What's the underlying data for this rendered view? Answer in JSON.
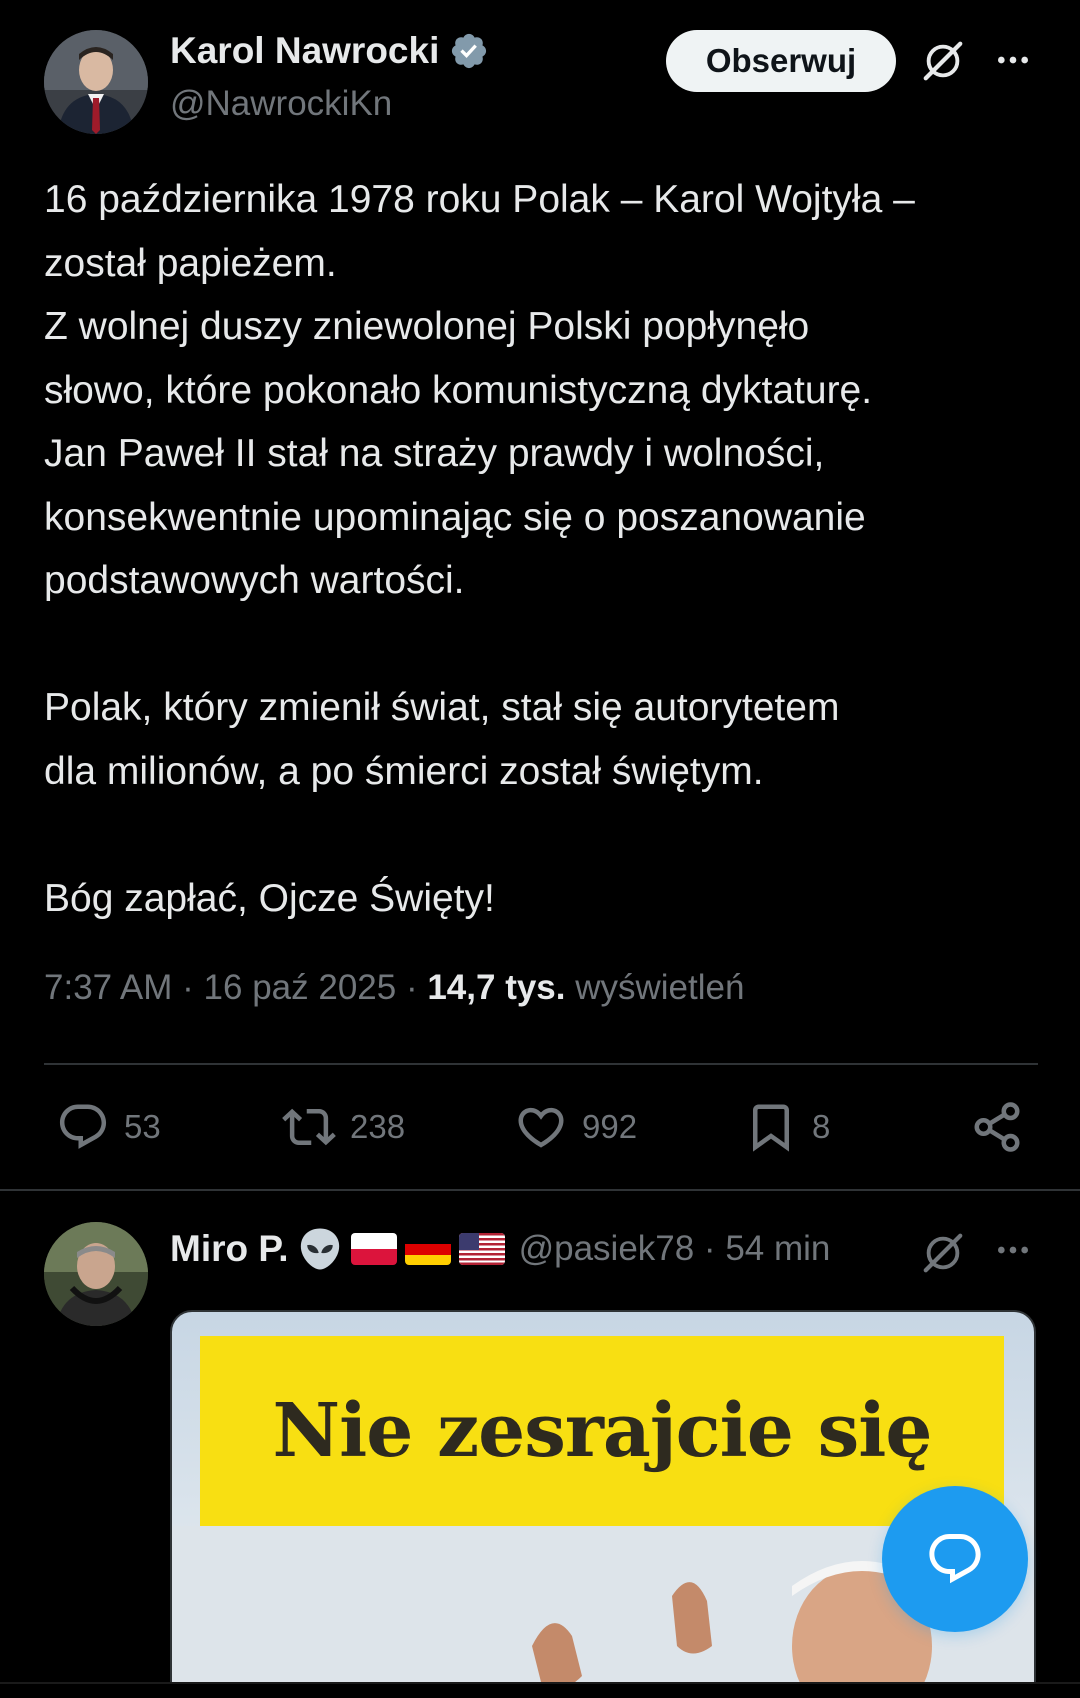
{
  "main_tweet": {
    "author_name": "Karol Nawrocki",
    "author_handle": "@NawrockiKn",
    "follow_label": "Obserwuj",
    "text": "16 października 1978 roku Polak – Karol Wojtyła –\nzostał papieżem.\nZ wolnej duszy zniewolonej Polski popłynęło\nsłowo, które pokonało komunistyczną dyktaturę.\nJan Paweł II stał na straży prawdy i wolności,\nkonsekwentnie upominając się o poszanowanie\npodstawowych wartości.\n\nPolak, który zmienił świat, stał się autorytetem\ndla milionów, a po śmierci został świętym.\n\nBóg zapłać, Ojcze Święty!",
    "time": "7:37 AM",
    "date": "16 paź 2025",
    "views_count": "14,7 tys.",
    "views_label": "wyświetleń",
    "separator": "·",
    "stats": {
      "replies": "53",
      "retweets": "238",
      "likes": "992",
      "bookmarks": "8"
    },
    "icons": [
      "verified-badge-icon",
      "grok-icon",
      "more-icon",
      "reply-icon",
      "retweet-icon",
      "like-icon",
      "bookmark-icon",
      "share-icon"
    ]
  },
  "reply_tweet": {
    "author_name": "Miro P.",
    "author_emojis": [
      "alien",
      "flag-poland",
      "flag-germany",
      "flag-usa"
    ],
    "author_handle": "@pasiek78 · 54 min",
    "media_caption": "Nie zesrajcie się"
  },
  "fab": {
    "icon": "compose-reply-icon"
  },
  "colors": {
    "background": "#000000",
    "text_primary": "#e7e9ea",
    "text_secondary": "#71767b",
    "accent": "#1d9bf0",
    "verified": "#829aab",
    "border": "#2f3336"
  }
}
